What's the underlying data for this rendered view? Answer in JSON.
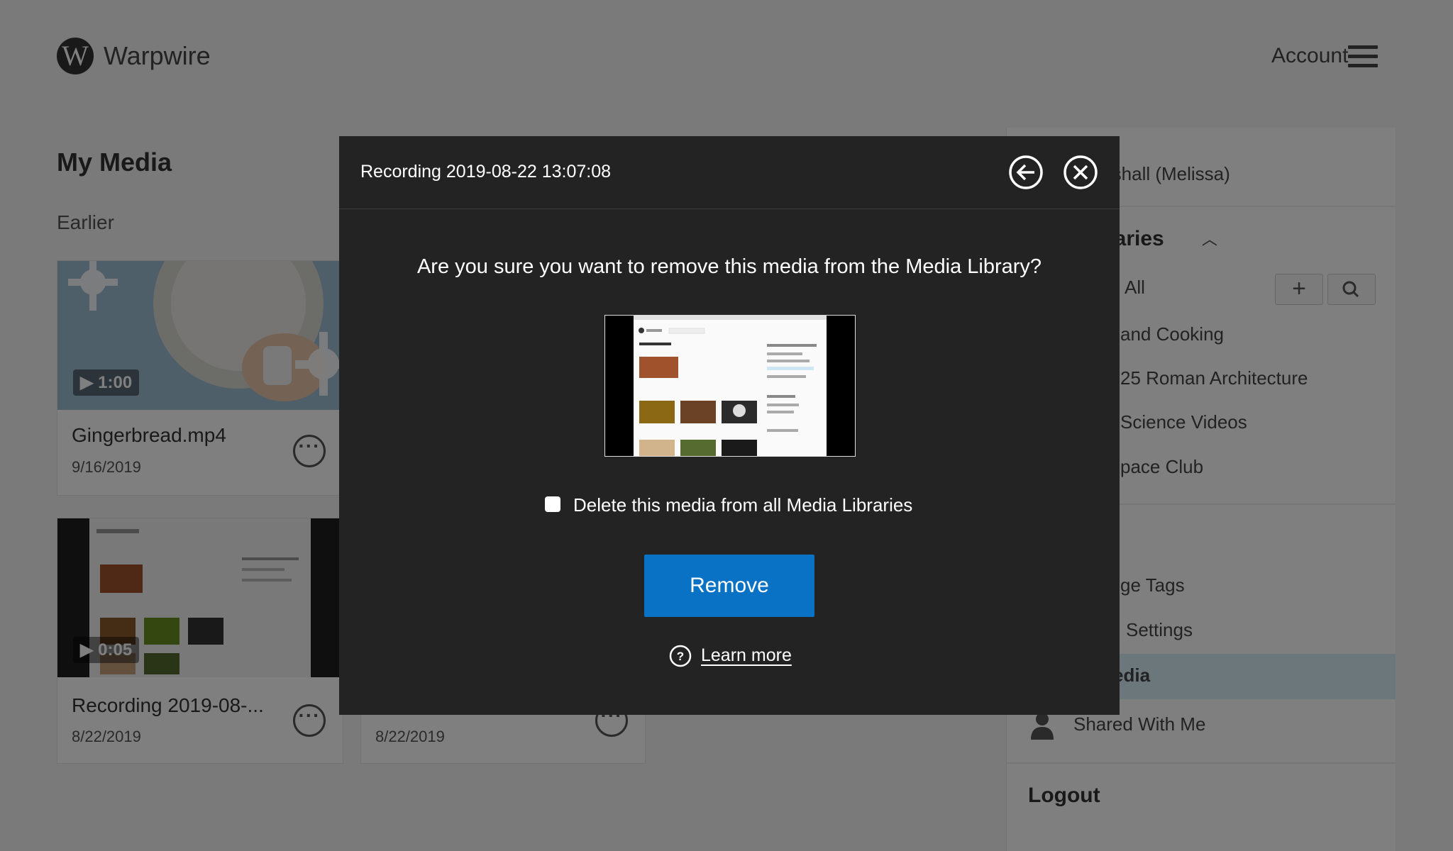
{
  "header": {
    "logo_letter": "W",
    "logo_text": "Warpwire",
    "account_label": "Account",
    "menu_icon": "hamburger-icon"
  },
  "main": {
    "title": "My Media",
    "section": "Earlier",
    "cards": [
      {
        "title": "Gingerbread.mp4",
        "date": "9/16/2019",
        "duration": "▶ 1:00"
      },
      {
        "title": "Recording 2019-08-...",
        "date": "8/22/2019",
        "duration": "▶ 0:05"
      },
      {
        "title": "",
        "date": "8/22/2019",
        "duration": ""
      }
    ]
  },
  "sidebar": {
    "user_name": "rshall (Melissa)",
    "libraries_heading": "raries",
    "libraries_all": "All",
    "libraries": [
      "and Cooking",
      "25 Roman Architecture",
      "Science Videos",
      "pace Club"
    ],
    "media_items": [
      "ge Tags",
      "Settings",
      "edia",
      "Shared With Me"
    ],
    "logout": "Logout"
  },
  "modal": {
    "title": "Recording 2019-08-22 13:07:08",
    "question": "Are you sure you want to remove this media from the Media Library?",
    "checkbox_label": "Delete this media from all Media Libraries",
    "checkbox_checked": false,
    "remove_label": "Remove",
    "learn_more_label": "Learn more",
    "accent": "#0a72c4"
  }
}
